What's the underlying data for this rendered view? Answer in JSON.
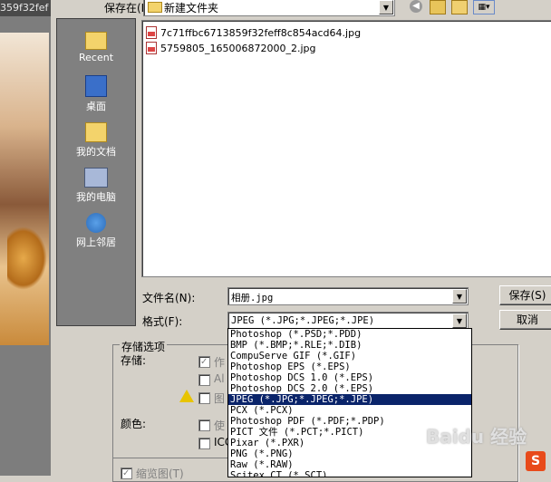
{
  "background_window": {
    "title": "359f32fef"
  },
  "dialog": {
    "save_in_label": "保存在(I):",
    "current_folder": "新建文件夹",
    "places": [
      {
        "label": "Recent",
        "icon": "recent-folder-icon"
      },
      {
        "label": "桌面",
        "icon": "desktop-icon"
      },
      {
        "label": "我的文档",
        "icon": "my-documents-icon"
      },
      {
        "label": "我的电脑",
        "icon": "my-computer-icon"
      },
      {
        "label": "网上邻居",
        "icon": "network-icon"
      }
    ],
    "files": [
      {
        "name": "7c71ffbc6713859f32feff8c854acd64.jpg"
      },
      {
        "name": "5759805_165006872000_2.jpg"
      }
    ],
    "filename_label": "文件名(N):",
    "filename_value": "相册.jpg",
    "format_label": "格式(F):",
    "format_value": "JPEG (*.JPG;*.JPEG;*.JPE)",
    "save_button": "保存(S)",
    "cancel_button": "取消",
    "save_options_group": "存储选项",
    "save_label": "存储:",
    "color_label": "颜色:",
    "option_as_copy": "作",
    "option_alpha": "Al",
    "option_layers": "图",
    "option_use": "使",
    "option_icc": "ICC",
    "thumbnail_label": "缩览图(T)",
    "format_options": [
      "Photoshop (*.PSD;*.PDD)",
      "BMP (*.BMP;*.RLE;*.DIB)",
      "CompuServe GIF (*.GIF)",
      "Photoshop EPS (*.EPS)",
      "Photoshop DCS 1.0 (*.EPS)",
      "Photoshop DCS 2.0 (*.EPS)",
      "JPEG (*.JPG;*.JPEG;*.JPE)",
      "PCX (*.PCX)",
      "Photoshop PDF (*.PDF;*.PDP)",
      "PICT 文件 (*.PCT;*.PICT)",
      "Pixar (*.PXR)",
      "PNG (*.PNG)",
      "Raw (*.RAW)",
      "Scitex CT (*.SCT)"
    ],
    "selected_format_index": 6
  },
  "watermark": {
    "text": "Baidu 经验"
  }
}
